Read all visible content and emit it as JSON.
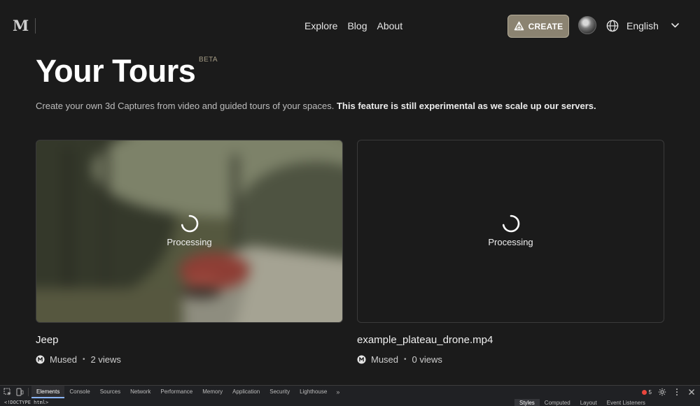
{
  "header": {
    "logo": "M",
    "nav": [
      "Explore",
      "Blog",
      "About"
    ],
    "create_label": "CREATE",
    "language": "English",
    "icons": {
      "create": "cube-pyramid-icon",
      "globe": "globe-icon",
      "chevron": "chevron-down-icon"
    }
  },
  "page": {
    "title": "Your Tours",
    "beta": "BETA",
    "subtitle": "Create your own 3d Captures from video and guided tours of your spaces.",
    "subtitle_bold": "This feature is still experimental as we scale up our servers."
  },
  "tours": [
    {
      "title": "Jeep",
      "status": "Processing",
      "author": "Mused",
      "views": "2 views",
      "thumbnail": "blurred-forest-road-with-red-jeep"
    },
    {
      "title": "example_plateau_drone.mp4",
      "status": "Processing",
      "author": "Mused",
      "views": "0 views",
      "thumbnail": "none"
    }
  ],
  "devtools": {
    "tabs": [
      "Elements",
      "Console",
      "Sources",
      "Network",
      "Performance",
      "Memory",
      "Application",
      "Security",
      "Lighthouse"
    ],
    "active_tab": "Elements",
    "more": "»",
    "error_count": "5",
    "doctype": "<!DOCTYPE html>",
    "subtabs": [
      "Styles",
      "Computed",
      "Layout",
      "Event Listeners"
    ],
    "active_subtab": "Styles"
  },
  "colors": {
    "background": "#1b1b1b",
    "create_button": "#8b8371",
    "beta": "#a39a84",
    "devtools_bg": "#202124"
  }
}
